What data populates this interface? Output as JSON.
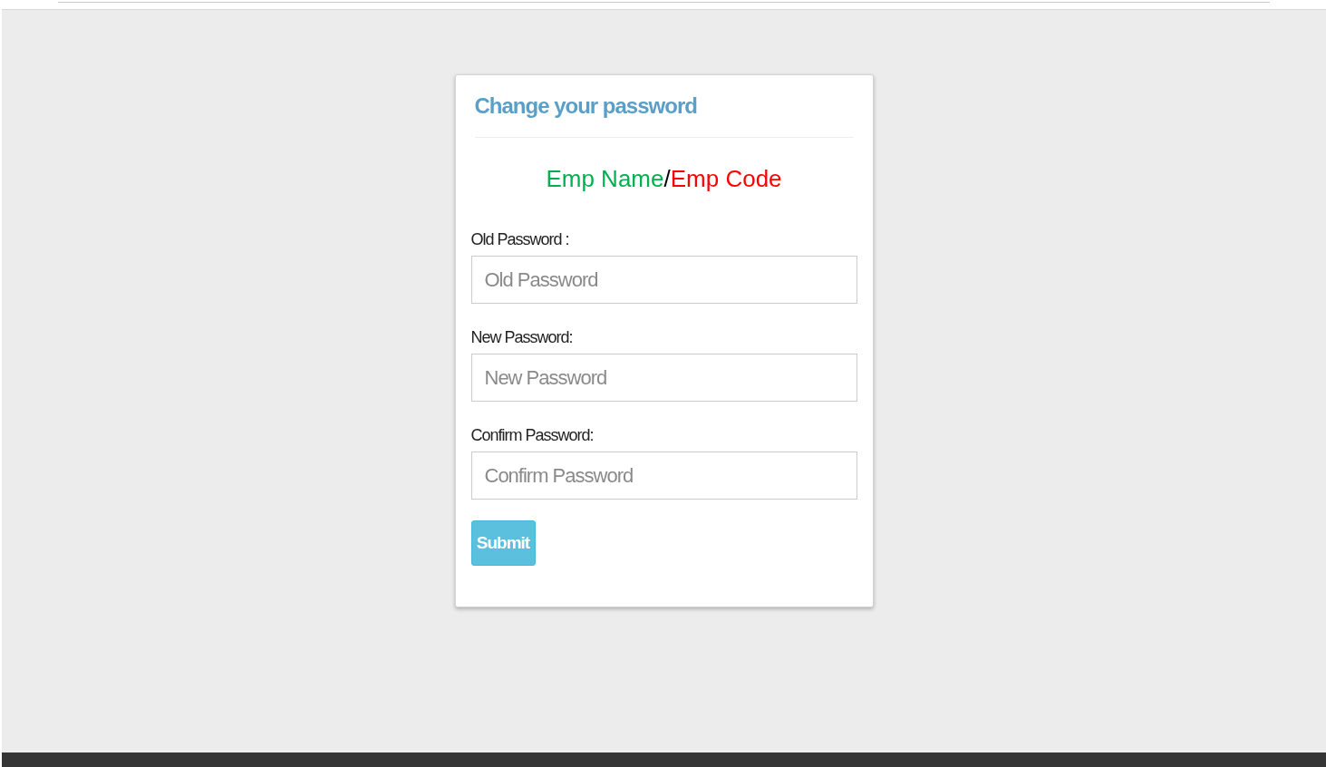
{
  "form": {
    "title": "Change your password",
    "identity": [
      {
        "text": "Emp Name",
        "color": "#00b050"
      },
      {
        "text": "/",
        "color": "#000000"
      },
      {
        "text": "Emp Code",
        "color": "#ff0000"
      }
    ],
    "fields": [
      {
        "label": "Old Password :",
        "placeholder": "Old Password"
      },
      {
        "label": "New Password:",
        "placeholder": "New Password"
      },
      {
        "label": "Confirm Password:",
        "placeholder": "Confirm Password"
      }
    ],
    "submit": "Submit"
  }
}
